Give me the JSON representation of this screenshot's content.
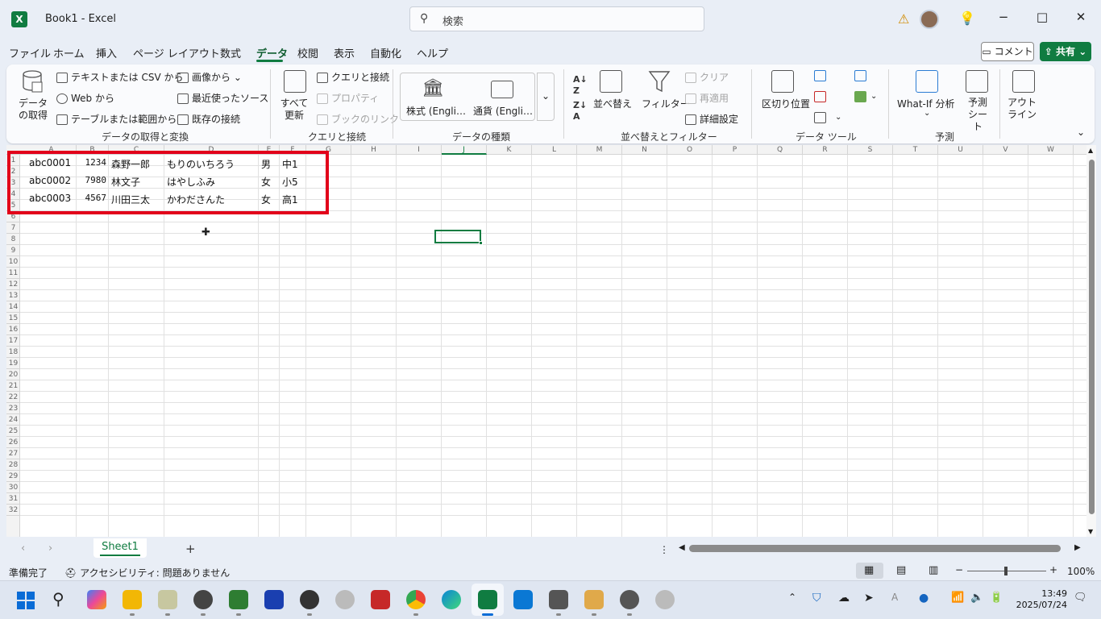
{
  "window": {
    "app_icon": "X",
    "title": "Book1  -  Excel",
    "search_placeholder": "検索",
    "controls": [
      "−",
      "□",
      "✕"
    ]
  },
  "tabs": [
    "ファイル",
    "ホーム",
    "挿入",
    "ページ レイアウト",
    "数式",
    "データ",
    "校閲",
    "表示",
    "自動化",
    "ヘルプ"
  ],
  "active_tab": "データ",
  "top_right": {
    "comment": "コメント",
    "share": "共有"
  },
  "ribbon": {
    "get_data": {
      "group_label": "データの取得と変換",
      "get_data_btn": "データの取得",
      "text_csv": "テキストまたは CSV から",
      "web": "Web から",
      "table_range": "テーブルまたは範囲から",
      "image": "画像から",
      "recent_sources": "最近使ったソース",
      "existing": "既存の接続"
    },
    "queries": {
      "group_label": "クエリと接続",
      "refresh_all": "すべて更新",
      "queries_conn": "クエリと接続",
      "properties": "プロパティ",
      "edit_links": "ブックのリンク"
    },
    "data_types": {
      "group_label": "データの種類",
      "stocks": "株式 (Engli…",
      "currency": "通貨 (Engli…"
    },
    "sort_filter": {
      "group_label": "並べ替えとフィルター",
      "sort": "並べ替え",
      "filter": "フィルター",
      "clear": "クリア",
      "reapply": "再適用",
      "advanced": "詳細設定"
    },
    "data_tools": {
      "group_label": "データ ツール",
      "text_to_columns": "区切り位置"
    },
    "forecast": {
      "group_label": "予測",
      "what_if": "What-If 分析",
      "forecast_sheet": "予測シート"
    },
    "outline": {
      "label": "アウトライン"
    }
  },
  "columns": [
    "A",
    "B",
    "C",
    "D",
    "E",
    "F",
    "G",
    "H",
    "I",
    "J",
    "K",
    "L",
    "M",
    "N",
    "O",
    "P",
    "Q",
    "R",
    "S",
    "T",
    "U",
    "V",
    "W"
  ],
  "selected_column": "J",
  "rows": [
    "1",
    "2",
    "3",
    "4",
    "5",
    "6",
    "7",
    "8",
    "9",
    "10",
    "11",
    "12",
    "13",
    "14",
    "15",
    "16",
    "17",
    "18",
    "19",
    "20",
    "21",
    "22",
    "23",
    "24",
    "25",
    "26",
    "27",
    "28",
    "29",
    "30",
    "31",
    "32"
  ],
  "cells": [
    [
      "abc0001",
      "1234",
      "森野一郎",
      "もりのいちろう",
      "男",
      "中1"
    ],
    [
      "abc0002",
      "7980",
      "林文子",
      "はやしふみ",
      "女",
      "小5"
    ],
    [
      "abc0003",
      "4567",
      "川田三太",
      "かわださんた",
      "女",
      "高1"
    ]
  ],
  "sheet": {
    "name": "Sheet1",
    "add": "+"
  },
  "status": {
    "ready": "準備完了",
    "accessibility": "アクセシビリティ: 問題ありません",
    "zoom": "100%",
    "zoom_minus": "−",
    "zoom_plus": "+"
  },
  "taskbar": {
    "time": "13:49",
    "date": "2025/07/24"
  }
}
